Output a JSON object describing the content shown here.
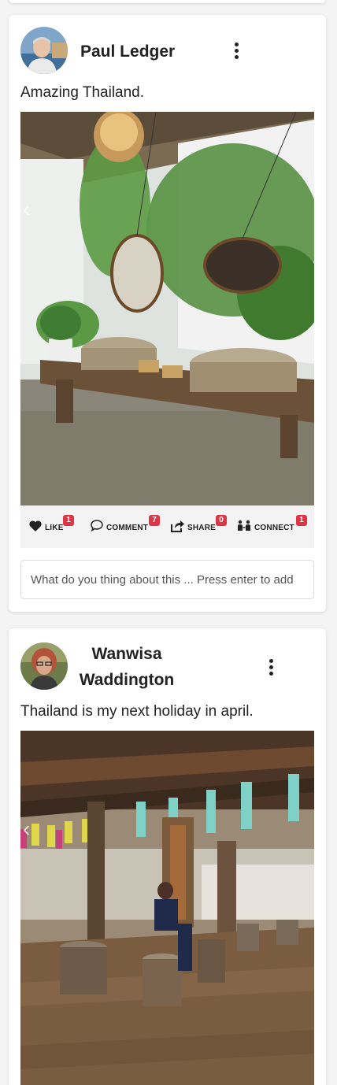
{
  "posts": [
    {
      "author": "Paul Ledger",
      "text": "Amazing Thailand.",
      "image_alt": "Stone basins with mirrors in a garden bathroom",
      "actions": {
        "like": {
          "label": "LIKE",
          "count": "1"
        },
        "comment": {
          "label": "COMMENT",
          "count": "7"
        },
        "share": {
          "label": "SHARE",
          "count": "0"
        },
        "connect": {
          "label": "CONNECT",
          "count": "1"
        }
      },
      "comment_placeholder": "What do you thing about this ... Press enter to add"
    },
    {
      "author": "Wanwisa Waddington",
      "text": "Thailand is my next holiday in april.",
      "image_alt": "Wooden hall with hanging lanterns"
    }
  ],
  "icons": [
    "more-vertical-icon",
    "heart-icon",
    "comment-icon",
    "share-icon",
    "connect-icon",
    "chevron-left-icon"
  ],
  "colors": {
    "badge": "#dc3545",
    "card": "#ffffff",
    "page": "#f4f4f5"
  }
}
